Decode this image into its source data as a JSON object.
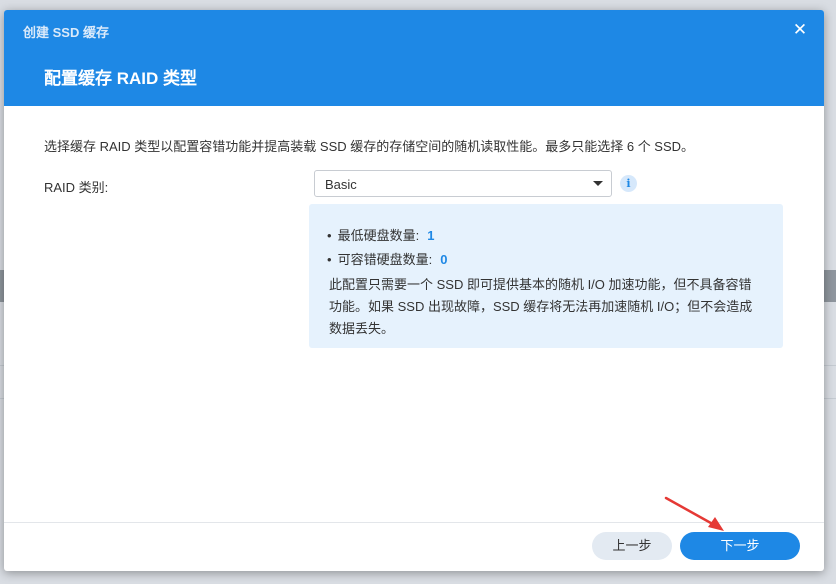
{
  "window": {
    "title": "创建 SSD 缓存",
    "close_icon": "close-icon"
  },
  "step": {
    "title": "配置缓存 RAID 类型"
  },
  "description": "选择缓存 RAID 类型以配置容错功能并提高装载 SSD 缓存的存储空间的随机读取性能。最多只能选择 6 个 SSD。",
  "raid": {
    "label": "RAID 类别:",
    "selected": "Basic",
    "info_icon": "info-icon"
  },
  "info": {
    "min_disks_label": "最低硬盘数量:",
    "min_disks_value": "1",
    "tolerance_label": "可容错硬盘数量:",
    "tolerance_value": "0",
    "note_line1": "此配置只需要一个 SSD 即可提供基本的随机 I/O 加速功能，但不具备容错",
    "note_line2": "功能。如果 SSD 出现故障，SSD 缓存将无法再加速随机 I/O；但不会造成",
    "note_line3": "数据丢失。"
  },
  "footer": {
    "prev_label": "上一步",
    "next_label": "下一步"
  },
  "colors": {
    "header": "#1e88e5",
    "accent": "#1e88e5",
    "info_bg": "#e6f2fd",
    "annotation": "#e53935"
  }
}
